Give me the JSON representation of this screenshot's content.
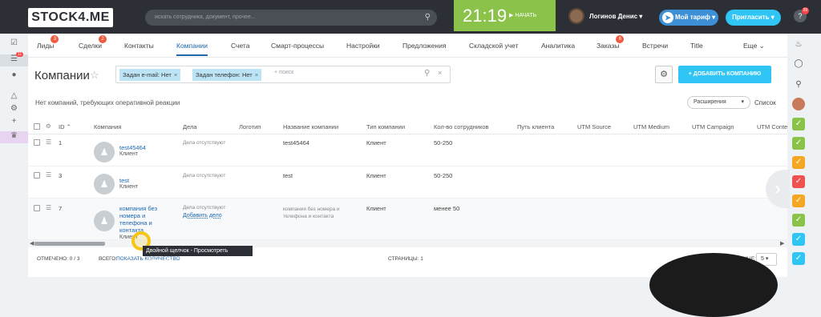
{
  "header": {
    "logo": "STOCK4.ME",
    "search_placeholder": "искать сотрудника, документ, прочее...",
    "clock_time": "21:19",
    "clock_button": "НАЧАТЬ",
    "user_name": "Логинов Денис",
    "tariff_label": "Мой тариф",
    "invite_label": "Пригласить",
    "help_badge": "99"
  },
  "left_sidebar": {
    "filter_badge": "11"
  },
  "nav": {
    "items": [
      {
        "label": "Лиды",
        "badge": "3"
      },
      {
        "label": "Сделки",
        "badge": "2"
      },
      {
        "label": "Контакты",
        "badge": ""
      },
      {
        "label": "Компании",
        "badge": ""
      },
      {
        "label": "Счета",
        "badge": ""
      },
      {
        "label": "Смарт-процессы",
        "badge": ""
      },
      {
        "label": "Настройки",
        "badge": ""
      },
      {
        "label": "Предложения",
        "badge": ""
      },
      {
        "label": "Складской учет",
        "badge": ""
      },
      {
        "label": "Аналитика",
        "badge": ""
      },
      {
        "label": "Заказы",
        "badge": "6"
      },
      {
        "label": "Встречи",
        "badge": ""
      },
      {
        "label": "Title",
        "badge": ""
      }
    ],
    "more_label": "Еще"
  },
  "page": {
    "title": "Компании",
    "filter_chips": [
      "Задан e-mail: Нет",
      "Задан телефон: Нет"
    ],
    "filter_placeholder": "+ поиск",
    "add_button": "ДОБАВИТЬ КОМПАНИЮ",
    "notice": "Нет компаний, требующих оперативной реакции",
    "expand_label": "Расширения",
    "list_label": "Список"
  },
  "table": {
    "headers": [
      "ID",
      "Компания",
      "Дела",
      "Логотип",
      "Название компании",
      "Тип компании",
      "Кол-во сотрудников",
      "Путь клиента",
      "UTM Source",
      "UTM Medium",
      "UTM Campaign",
      "UTM Conte"
    ],
    "rows": [
      {
        "id": "1",
        "company": "test45464",
        "type": "Клиент",
        "deals": "Дела отсутствуют",
        "deals_link": "",
        "name": "test45464",
        "ctype": "Клиент",
        "employees": "50-250"
      },
      {
        "id": "3",
        "company": "test",
        "type": "Клиент",
        "deals": "Дела отсутствуют",
        "deals_link": "",
        "name": "test",
        "ctype": "Клиент",
        "employees": "50-250"
      },
      {
        "id": "7",
        "company_lines": [
          "компания без",
          "номера и",
          "телефона и",
          "контакта"
        ],
        "type": "Клиент",
        "deals": "Дела отсутствуют",
        "deals_link": "Добавить дело",
        "name_lines": [
          "компания без номера и",
          "телефона и контакта"
        ],
        "ctype": "Клиент",
        "employees": "менее 50"
      }
    ]
  },
  "footer": {
    "selected": "ОТМЕЧЕНО: 0 / 3",
    "total_label": "ВСЕГО:",
    "total_link": "ПОКАЗАТЬ КОЛИЧЕСТВО",
    "pages": "СТРАНИЦЫ: 1",
    "per_page_label": "НА СТРАНИЦЕ:",
    "per_page_value": "5"
  },
  "tooltip": "Двойной щелчок - Просмотреть компанию",
  "colors": {
    "topbar": "#2c3036",
    "accent": "#2fc6f6",
    "clock": "#8bc34a",
    "link": "#2067b0"
  }
}
